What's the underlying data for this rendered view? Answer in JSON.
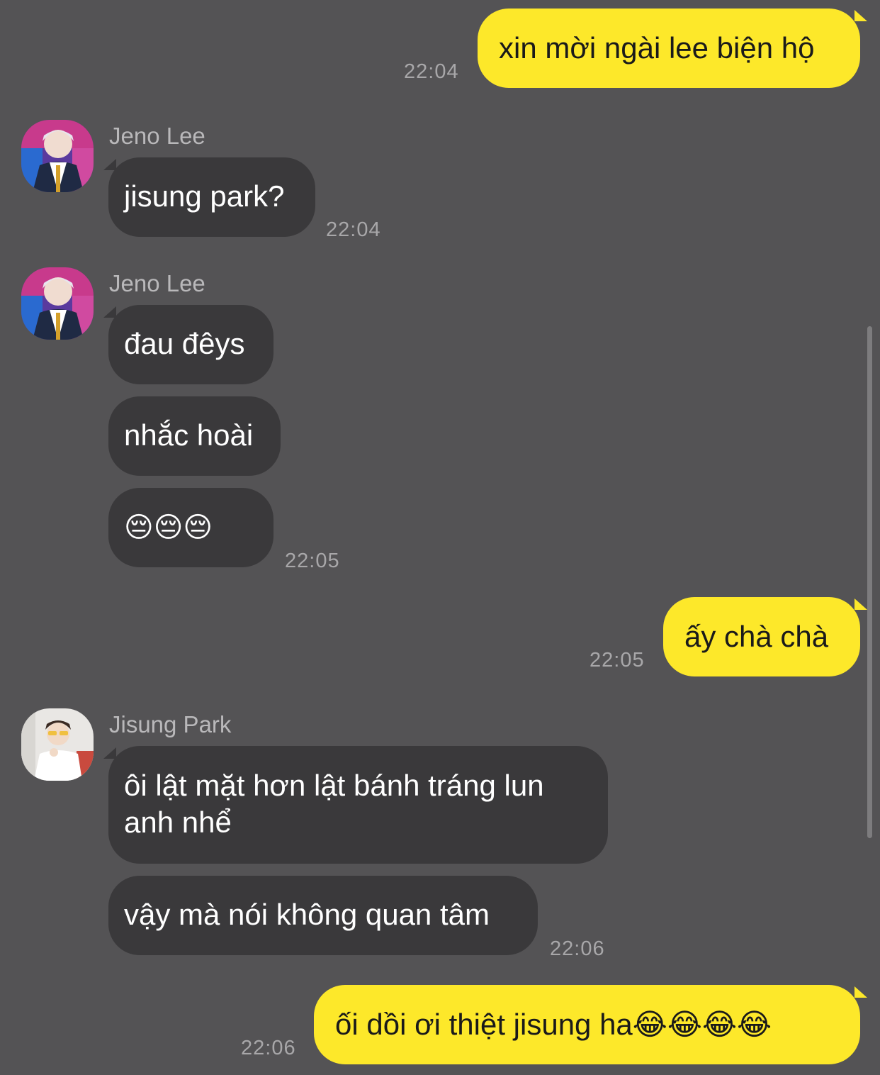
{
  "messages": [
    {
      "text": "xin mời ngài lee biện hộ",
      "time": "22:04"
    },
    {
      "sender": "Jeno Lee",
      "text": "jisung park?",
      "time": "22:04"
    },
    {
      "sender": "Jeno Lee",
      "text": "đau đêys"
    },
    {
      "text": "nhắc hoài"
    },
    {
      "text": "😔😔😔",
      "time": "22:05"
    },
    {
      "text": "ấy chà chà",
      "time": "22:05"
    },
    {
      "sender": "Jisung Park",
      "text": "ôi lật mặt hơn lật bánh tráng lun anh nhể"
    },
    {
      "text": "vậy mà nói không quan tâm",
      "time": "22:06"
    },
    {
      "text": "ối dồi ơi thiệt jisung ha😂😂😂😂",
      "time": "22:06"
    }
  ],
  "avatars": {
    "jeno": "avatar-jeno-lee",
    "jisung": "avatar-jisung-park"
  },
  "colors": {
    "background": "#545355",
    "incoming_bubble": "#3a393b",
    "outgoing_bubble": "#fde82a"
  }
}
